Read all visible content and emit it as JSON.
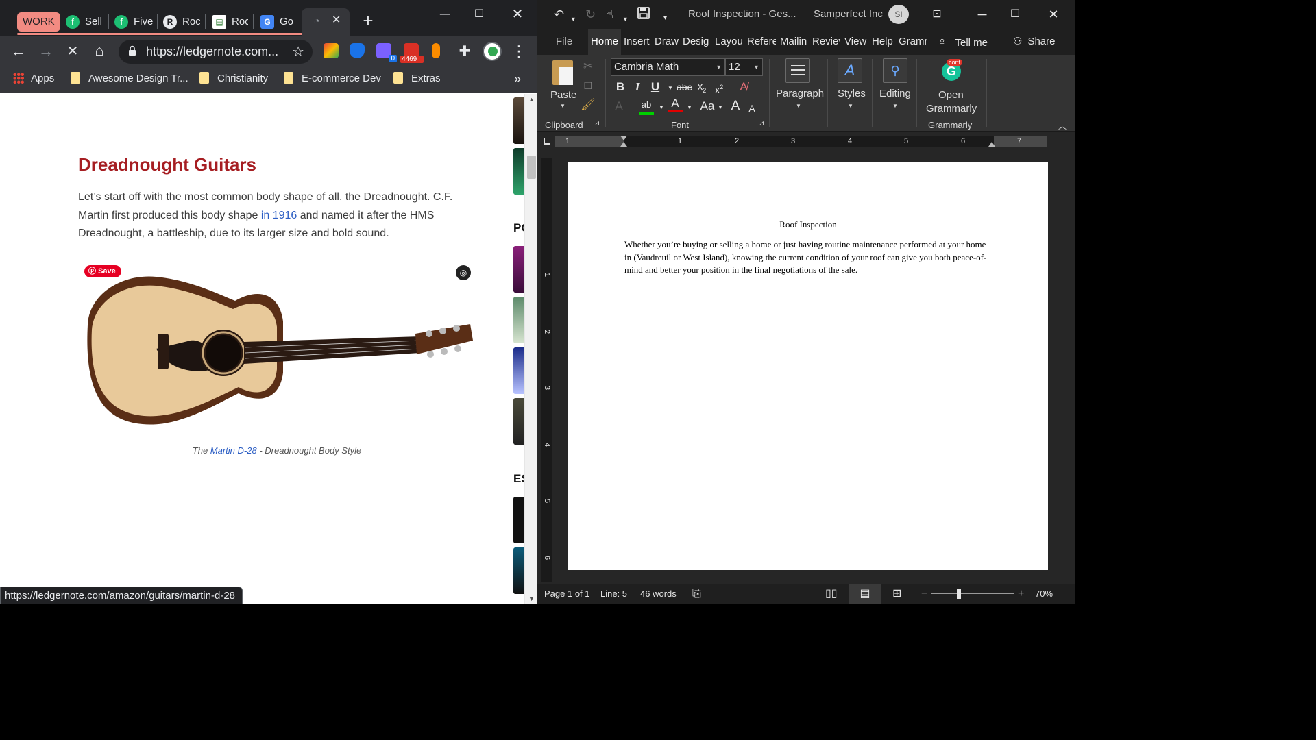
{
  "chrome": {
    "tab_group": "WORK",
    "tabs": [
      {
        "label": "Sell",
        "icon": "fiverr-icon"
      },
      {
        "label": "Five",
        "icon": "fiverr-icon"
      },
      {
        "label": "Roc",
        "icon": "roofing-icon"
      },
      {
        "label": "Roc",
        "icon": "document-icon"
      },
      {
        "label": "Go",
        "icon": "google-translate-icon"
      },
      {
        "label": "",
        "icon": "loading-spinner-icon",
        "active": true
      }
    ],
    "url": "https://ledgernote.com...",
    "bookmarks": {
      "apps": "Apps",
      "items": [
        "Awesome Design Tr...",
        "Christianity",
        "E-commerce Dev",
        "Extras"
      ]
    },
    "badge_count_a": "0",
    "badge_count_mail": "4469",
    "status_url": "https://ledgernote.com/amazon/guitars/martin-d-28"
  },
  "article": {
    "title": "Dreadnought Guitars",
    "para_1": "Let’s start off with the most common body shape of all, the Dreadnought. C.F. Martin first produced this body shape ",
    "para_link": "in 1916",
    "para_2": " and named it after the HMS Dreadnought, a battleship, due to its larger size and bold sound.",
    "save_label": "Save",
    "caption_pre": "The ",
    "caption_link": "Martin D-28",
    "caption_post": " - Dreadnought Body Style",
    "side_head_1": "PO",
    "side_head_2": "ES"
  },
  "word": {
    "doc_title": "Roof Inspection - Ges...",
    "org": "Samperfect Inc",
    "avatar": "SI",
    "tabs": [
      "File",
      "Home",
      "Insert",
      "Draw",
      "Design",
      "Layout",
      "References",
      "Mailings",
      "Review",
      "View",
      "Help",
      "Grammarly"
    ],
    "tabs_display": [
      "File",
      "Home",
      "Insert",
      "Draw",
      "Desig",
      "Layou",
      "Refere",
      "Mailin",
      "Reviev",
      "View",
      "Help",
      "Gramr"
    ],
    "tell_me": "Tell me",
    "share": "Share",
    "ribbon": {
      "paste": "Paste",
      "clipboard": "Clipboard",
      "font_name": "Cambria Math",
      "font_size": "12",
      "font_group": "Font",
      "paragraph": "Paragraph",
      "styles": "Styles",
      "editing": "Editing",
      "open": "Open",
      "grammarly": "Grammarly",
      "grammarly_group": "Grammarly",
      "conf_badge": "conf"
    },
    "ruler_h": [
      "1",
      "1",
      "2",
      "3",
      "4",
      "5",
      "6",
      "7"
    ],
    "ruler_v": [
      "1",
      "2",
      "3",
      "4",
      "5",
      "6"
    ],
    "doc": {
      "heading": "Roof Inspection",
      "paragraph": "Whether you’re buying or selling a home or just having routine maintenance performed at your home in (Vaudreuil or West Island), knowing the current condition of your roof can give you both peace-of-mind and better your position in the final negotiations of the sale."
    },
    "status": {
      "page": "Page 1 of 1",
      "line": "Line: 5",
      "words": "46 words",
      "zoom": "70%"
    }
  },
  "colors": {
    "accent_title": "#a61e22",
    "link": "#2c5ec4",
    "tab_group": "#f28b82",
    "pinterest": "#e60023"
  }
}
